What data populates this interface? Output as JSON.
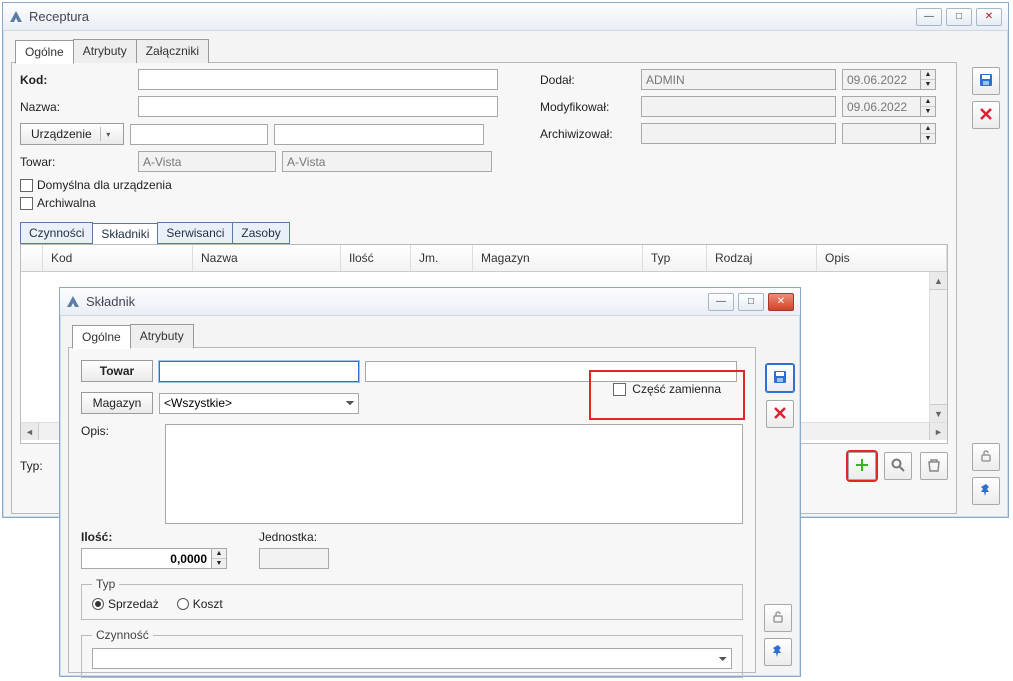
{
  "main_window": {
    "title": "Receptura",
    "tabs": [
      "Ogólne",
      "Atrybuty",
      "Załączniki"
    ],
    "active_tab": 0,
    "labels": {
      "kod": "Kod:",
      "nazwa": "Nazwa:",
      "urzadzenie_btn": "Urządzenie",
      "towar": "Towar:",
      "towar_val1": "A-Vista",
      "towar_val2": "A-Vista",
      "domyslna": "Domyślna dla urządzenia",
      "archiwalna": "Archiwalna",
      "dodal": "Dodał:",
      "dodal_val": "ADMIN",
      "dodal_date": "09.06.2022",
      "modyfikowal": "Modyfikował:",
      "mod_date": "09.06.2022",
      "archiwizowal": "Archiwizował:",
      "typ": "Typ:"
    },
    "sub_tabs": [
      "Czynności",
      "Składniki",
      "Serwisanci",
      "Zasoby"
    ],
    "active_sub_tab": 1,
    "table_headers": [
      "Kod",
      "Nazwa",
      "Ilość",
      "Jm.",
      "Magazyn",
      "Typ",
      "Rodzaj",
      "Opis"
    ]
  },
  "dialog": {
    "title": "Składnik",
    "tabs": [
      "Ogólne",
      "Atrybuty"
    ],
    "active_tab": 0,
    "labels": {
      "towar_btn": "Towar",
      "magazyn_btn": "Magazyn",
      "magazyn_val": "<Wszystkie>",
      "czesc_zamienna": "Część zamienna",
      "opis": "Opis:",
      "ilosc": "Ilość:",
      "ilosc_val": "0,0000",
      "jednostka": "Jednostka:",
      "typ_legend": "Typ",
      "typ_sprzedaz": "Sprzedaż",
      "typ_koszt": "Koszt",
      "czynnosc_legend": "Czynność"
    }
  },
  "icons": {
    "minimize": "—",
    "maximize": "□",
    "close": "✕",
    "up": "▲",
    "down": "▼",
    "left": "◄",
    "right": "►",
    "dd": "▾"
  }
}
